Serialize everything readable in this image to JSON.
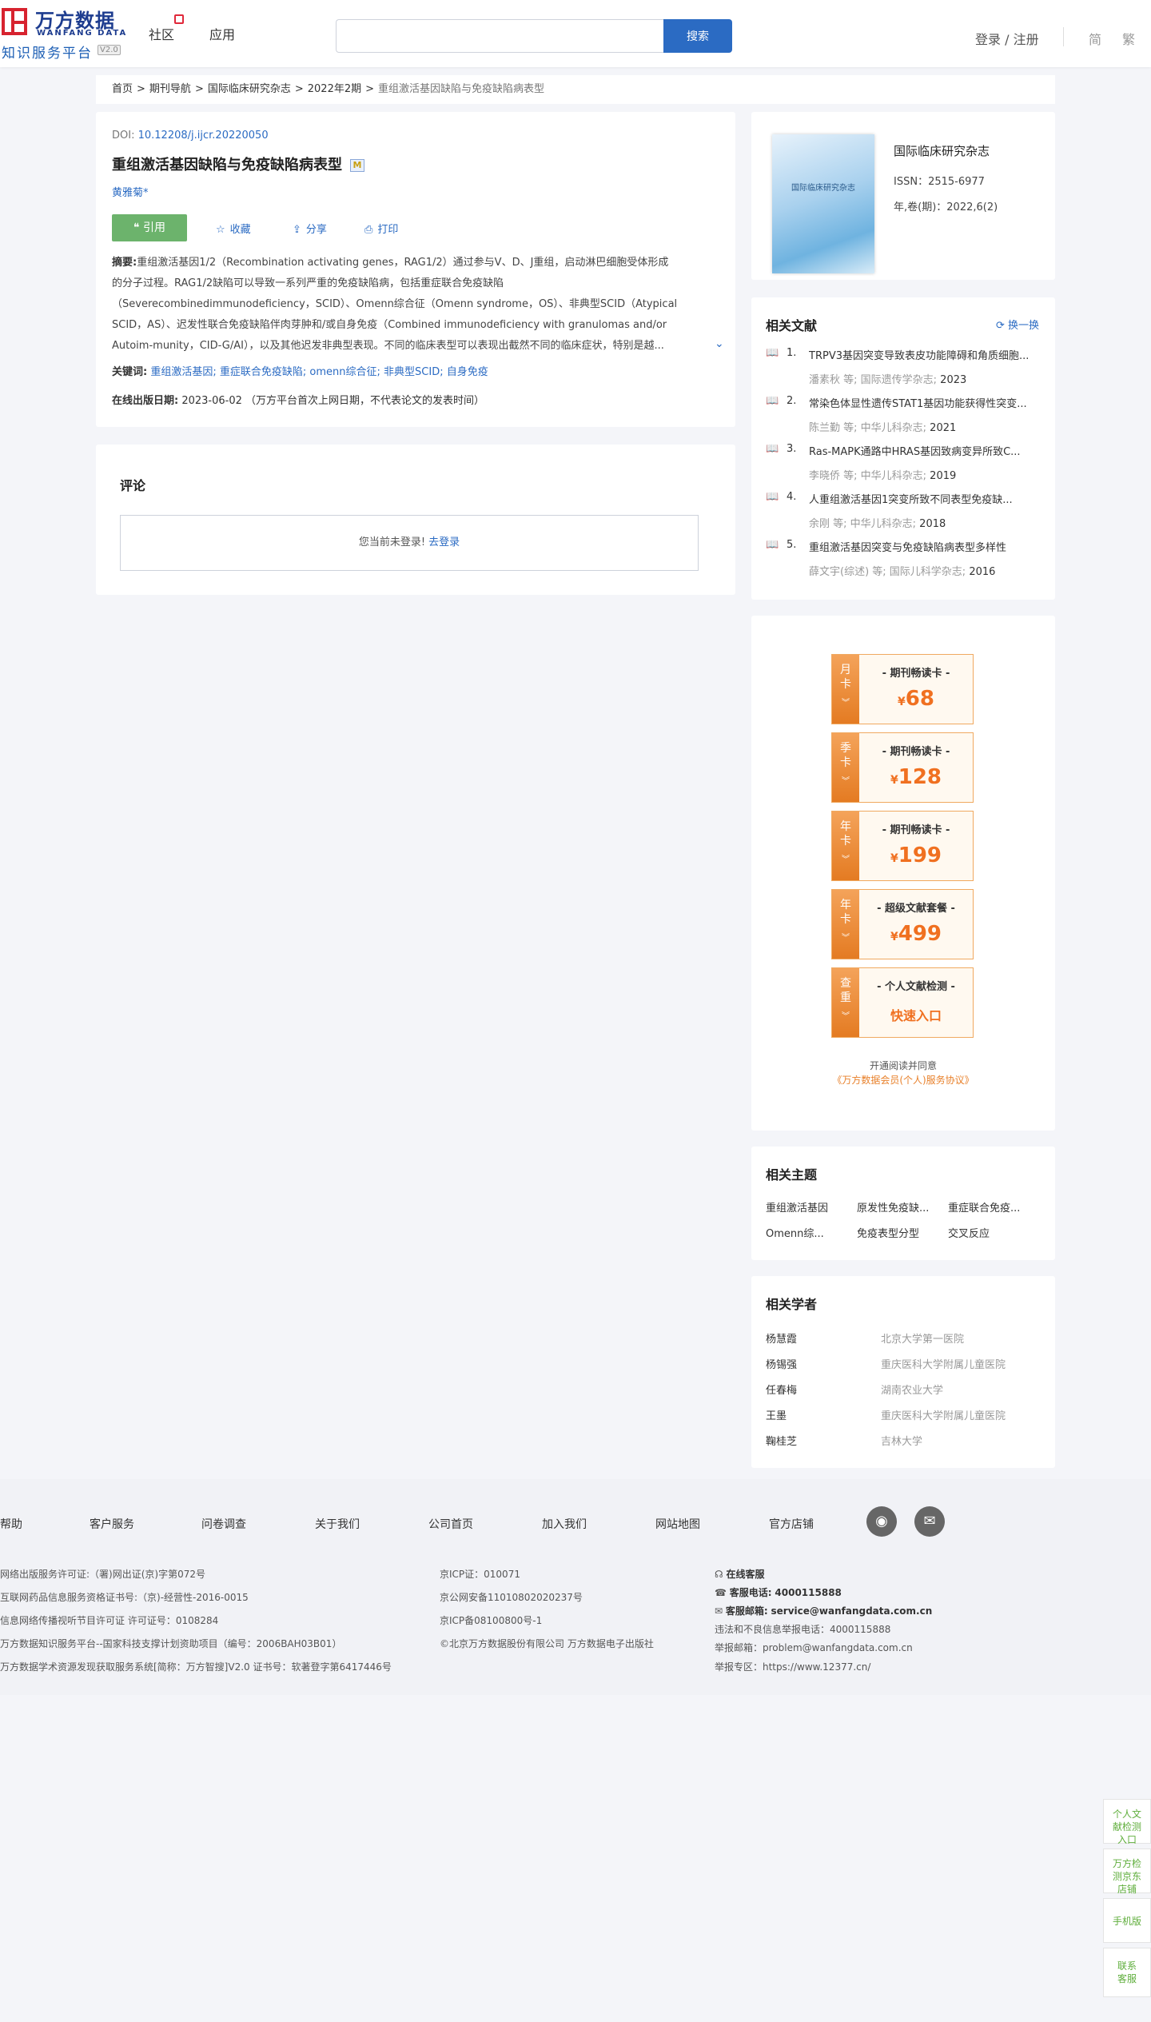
{
  "header": {
    "logo_cn": "万方数据",
    "logo_en": "WANFANG DATA",
    "logo_sub": "知识服务平台",
    "logo_ver": "V2.0",
    "nav": [
      "社区",
      "应用"
    ],
    "search_placeholder": "",
    "search_btn": "搜索",
    "login": "登录 / 注册",
    "lang_simple": "简",
    "lang_trad": "繁"
  },
  "breadcrumb": {
    "items": [
      "首页",
      "期刊导航",
      "国际临床研究杂志",
      "2022年2期"
    ],
    "current": "重组激活基因缺陷与免疫缺陷病表型",
    "sep": ">"
  },
  "article": {
    "doi_label": "DOI:",
    "doi": "10.12208/j.ijcr.20220050",
    "title": "重组激活基因缺陷与免疫缺陷病表型",
    "badge": "M",
    "author": "黄雅菊*",
    "cite": "引用",
    "favorite": "收藏",
    "share": "分享",
    "print": "打印",
    "abstract_label": "摘要:",
    "abstract_lines": [
      "重组激活基因1/2（Recombination activating genes，RAG1/2）通过参与V、D、J重组，启动淋巴细胞受体形成",
      "的分子过程。RAG1/2缺陷可以导致一系列严重的免疫缺陷病，包括重症联合免疫缺陷",
      "（Severecombinedimmunodeficiency，SCID）、Omenn综合征（Omenn syndrome，OS）、非典型SCID（Atypical",
      "SCID，AS）、迟发性联合免疫缺陷伴肉芽肿和/或自身免疫（Combined immunodeficiency with granulomas and/or",
      "Autoim-munity，CID-G/AI），以及其他迟发非典型表现。不同的临床表型可以表现出截然不同的临床症状，特别是越..."
    ],
    "keywords_label": "关键词:",
    "keywords": [
      "重组激活基因;",
      "重症联合免疫缺陷;",
      "omenn综合征;",
      "非典型SCID;",
      "自身免疫"
    ],
    "pub_label": "在线出版日期:",
    "pub_date": "2023-06-02",
    "pub_note": "（万方平台首次上网日期，不代表论文的发表时间）"
  },
  "comment": {
    "title": "评论",
    "msg": "您当前未登录!",
    "login_link": "去登录"
  },
  "journal": {
    "cover_text": "国际临床研究杂志",
    "name": "国际临床研究杂志",
    "issn": "ISSN：2515-6977",
    "issue": "年,卷(期)：2022,6(2)"
  },
  "related": {
    "title": "相关文献",
    "swap": "换一换",
    "items": [
      {
        "num": "1.",
        "title": "TRPV3基因突变导致表皮功能障碍和角质细胞...",
        "meta": "潘素秋 等; 国际遗传学杂志; ",
        "year": "2023"
      },
      {
        "num": "2.",
        "title": "常染色体显性遗传STAT1基因功能获得性突变...",
        "meta": "陈兰勤 等; 中华儿科杂志; ",
        "year": "2021"
      },
      {
        "num": "3.",
        "title": "Ras-MAPK通路中HRAS基因致病变异所致C...",
        "meta": "李晓侨 等; 中华儿科杂志; ",
        "year": "2019"
      },
      {
        "num": "4.",
        "title": "人重组激活基因1突变所致不同表型免疫缺...",
        "meta": "余刚 等; 中华儿科杂志; ",
        "year": "2018"
      },
      {
        "num": "5.",
        "title": "重组激活基因突变与免疫缺陷病表型多样性",
        "meta": "薛文宇(综述) 等; 国际儿科学杂志; ",
        "year": "2016"
      }
    ]
  },
  "promos": [
    {
      "tab": [
        "月",
        "卡"
      ],
      "head": "- 期刊畅读卡 -",
      "price": "68",
      "currency": "¥"
    },
    {
      "tab": [
        "季",
        "卡"
      ],
      "head": "- 期刊畅读卡 -",
      "price": "128",
      "currency": "¥"
    },
    {
      "tab": [
        "年",
        "卡"
      ],
      "head": "- 期刊畅读卡 -",
      "price": "199",
      "currency": "¥"
    },
    {
      "tab": [
        "年",
        "卡"
      ],
      "head": "- 超级文献套餐 -",
      "price": "499",
      "currency": "¥"
    },
    {
      "tab": [
        "查",
        "重"
      ],
      "head": "- 个人文献检测 -",
      "price": "快速入口",
      "currency": ""
    }
  ],
  "promo_note": {
    "line1": "开通阅读并同意",
    "line2": "《万方数据会员(个人)服务协议》"
  },
  "topics": {
    "title": "相关主题",
    "items": [
      "重组激活基因",
      "原发性免疫缺...",
      "重症联合免疫...",
      "Omenn综...",
      "免疫表型分型",
      "交叉反应"
    ]
  },
  "scholars": {
    "title": "相关学者",
    "items": [
      {
        "name": "杨慧霞",
        "org": "北京大学第一医院"
      },
      {
        "name": "杨锡强",
        "org": "重庆医科大学附属儿童医院"
      },
      {
        "name": "任春梅",
        "org": "湖南农业大学"
      },
      {
        "name": "王墨",
        "org": "重庆医科大学附属儿童医院"
      },
      {
        "name": "鞠桂芝",
        "org": "吉林大学"
      }
    ]
  },
  "footer": {
    "links": [
      "帮助",
      "客户服务",
      "问卷调查",
      "关于我们",
      "公司首页",
      "加入我们",
      "网站地图",
      "官方店铺"
    ],
    "col1": [
      "网络出版服务许可证:（署)网出证(京)字第072号",
      "互联网药品信息服务资格证书号:（京)-经营性-2016-0015",
      "信息网络传播视听节目许可证 许可证号：0108284",
      "万方数据知识服务平台--国家科技支撑计划资助项目（编号：2006BAH03B01）",
      "万方数据学术资源发现获取服务系统[简称：万方智搜]V2.0 证书号：软著登字第6417446号"
    ],
    "col2": [
      "京ICP证：010071",
      "京公网安备11010802020237号",
      "京ICP备08100800号-1",
      "©北京万方数据股份有限公司 万方数据电子出版社"
    ],
    "online_service": "在线客服",
    "phone_label": "客服电话:",
    "phone": "4000115888",
    "email_label": "客服邮箱:",
    "email": "service@wanfangdata.com.cn",
    "report_phone": "违法和不良信息举报电话：4000115888",
    "report_email": "举报邮箱：problem@wanfangdata.com.cn",
    "report_zone": "举报专区：https://www.12377.cn/"
  },
  "side": [
    "个人文献检测入口",
    "万方检测京东店铺",
    "手机版",
    "联系客服"
  ]
}
